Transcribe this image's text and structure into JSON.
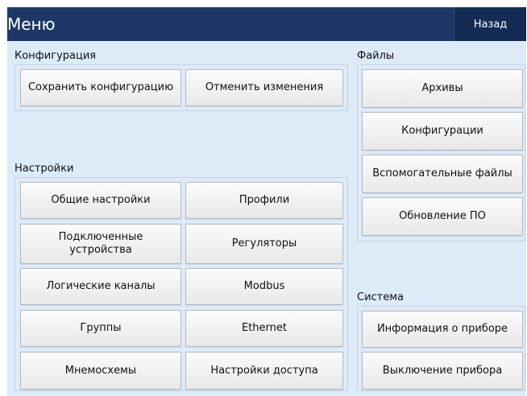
{
  "header": {
    "title": "Меню",
    "back_label": "Назад"
  },
  "configuration": {
    "title": "Конфигурация",
    "save_label": "Сохранить конфигурацию",
    "cancel_label": "Отменить изменения"
  },
  "settings": {
    "title": "Настройки",
    "general": "Общие настройки",
    "profiles": "Профили",
    "connected_devices": "Подключенные устройства",
    "regulators": "Регуляторы",
    "logic_channels": "Логические каналы",
    "modbus": "Modbus",
    "groups": "Группы",
    "ethernet": "Ethernet",
    "mnemo": "Мнемосхемы",
    "access": "Настройки доступа"
  },
  "files": {
    "title": "Файлы",
    "archives": "Архивы",
    "configurations": "Конфигурации",
    "aux_files": "Вспомогательные файлы",
    "update": "Обновление ПО"
  },
  "system": {
    "title": "Система",
    "device_info": "Информация о приборе",
    "shutdown": "Выключение прибора"
  }
}
